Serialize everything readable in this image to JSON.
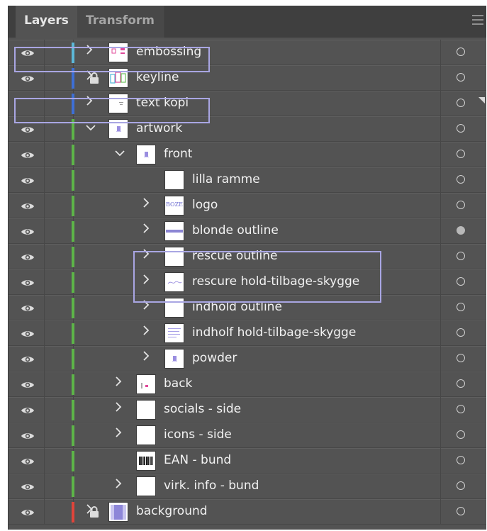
{
  "tabs": [
    {
      "label": "Layers",
      "active": true
    },
    {
      "label": "Transform",
      "active": false
    }
  ],
  "icons": {
    "visibility": "eye-icon",
    "lock": "lock-icon",
    "expand": "chevron-right-icon",
    "collapse": "chevron-down-icon",
    "target": "target-circle-icon",
    "menu": "hamburger-menu-icon"
  },
  "colors": {
    "panel": "#535353",
    "tabbar": "#3f3f3f",
    "highlight_outline": "#a9a6e3"
  },
  "layers": [
    {
      "name": "embossing",
      "depth": 0,
      "visible": true,
      "locked": false,
      "color": "#5cb8d8",
      "disclosure": "collapsed",
      "thumb": "pink",
      "target_filled": false
    },
    {
      "name": "keyline",
      "depth": 0,
      "visible": true,
      "locked": true,
      "color": "#3d6fd6",
      "disclosure": "collapsed",
      "thumb": "multi",
      "target_filled": false
    },
    {
      "name": "text kopi",
      "depth": 0,
      "visible": false,
      "locked": false,
      "color": "#3d6fd6",
      "disclosure": "collapsed",
      "thumb": "text",
      "target_filled": false
    },
    {
      "name": "artwork",
      "depth": 0,
      "visible": true,
      "locked": false,
      "color": "#5db548",
      "disclosure": "expanded",
      "thumb": "small",
      "target_filled": false
    },
    {
      "name": "front",
      "depth": 1,
      "visible": true,
      "locked": false,
      "color": "#5db548",
      "disclosure": "expanded",
      "thumb": "small",
      "target_filled": false
    },
    {
      "name": "lilla ramme",
      "depth": 2,
      "visible": true,
      "locked": false,
      "color": "#5db548",
      "disclosure": "none",
      "thumb": "blank",
      "target_filled": false
    },
    {
      "name": "logo",
      "depth": 2,
      "visible": true,
      "locked": false,
      "color": "#5db548",
      "disclosure": "collapsed",
      "thumb": "logo",
      "thumb_text": "BOZE",
      "target_filled": false
    },
    {
      "name": "blonde outline",
      "depth": 2,
      "visible": true,
      "locked": false,
      "color": "#5db548",
      "disclosure": "collapsed",
      "thumb": "band",
      "target_filled": true
    },
    {
      "name": "rescue outline",
      "depth": 2,
      "visible": true,
      "locked": false,
      "color": "#5db548",
      "disclosure": "collapsed",
      "thumb": "blank",
      "target_filled": false
    },
    {
      "name": "rescure hold-tilbage-skygge",
      "depth": 2,
      "visible": true,
      "locked": false,
      "color": "#5db548",
      "disclosure": "collapsed",
      "thumb": "script",
      "target_filled": false
    },
    {
      "name": "indhold outline",
      "depth": 2,
      "visible": true,
      "locked": false,
      "color": "#5db548",
      "disclosure": "collapsed",
      "thumb": "blank",
      "target_filled": false
    },
    {
      "name": "indholf hold-tilbage-skygge",
      "depth": 2,
      "visible": true,
      "locked": false,
      "color": "#5db548",
      "disclosure": "collapsed",
      "thumb": "lines",
      "target_filled": false
    },
    {
      "name": "powder",
      "depth": 2,
      "visible": true,
      "locked": false,
      "color": "#5db548",
      "disclosure": "collapsed",
      "thumb": "small",
      "target_filled": false
    },
    {
      "name": "back",
      "depth": 1,
      "visible": true,
      "locked": false,
      "color": "#5db548",
      "disclosure": "collapsed",
      "thumb": "pinkdot",
      "target_filled": false
    },
    {
      "name": "socials - side",
      "depth": 1,
      "visible": true,
      "locked": false,
      "color": "#5db548",
      "disclosure": "collapsed",
      "thumb": "blank",
      "target_filled": false
    },
    {
      "name": "icons - side",
      "depth": 1,
      "visible": true,
      "locked": false,
      "color": "#5db548",
      "disclosure": "collapsed",
      "thumb": "blank",
      "target_filled": false
    },
    {
      "name": "EAN - bund",
      "depth": 1,
      "visible": true,
      "locked": false,
      "color": "#5db548",
      "disclosure": "none",
      "thumb": "barcode",
      "target_filled": false
    },
    {
      "name": "virk. info - bund",
      "depth": 1,
      "visible": true,
      "locked": false,
      "color": "#5db548",
      "disclosure": "collapsed",
      "thumb": "blank",
      "target_filled": false
    },
    {
      "name": "background",
      "depth": 0,
      "visible": true,
      "locked": true,
      "color": "#e0443a",
      "disclosure": "collapsed",
      "thumb": "box",
      "target_filled": false
    }
  ]
}
